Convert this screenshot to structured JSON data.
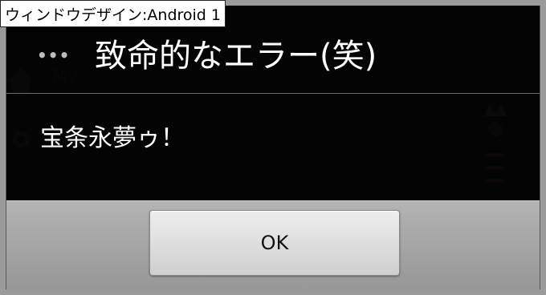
{
  "caption": "ウィンドウデザイン:Android 1",
  "dialog": {
    "title": "致命的なエラー(笑)",
    "message": "宝条永夢ゥ！",
    "ok_label": "OK",
    "menu_icon": "overflow-dots-icon"
  },
  "background_app": {
    "visible_text": "My"
  },
  "colors": {
    "dialog_body": "#000000",
    "button_bar": "#a8a8a8",
    "button_face": "#e0e0e0",
    "title_text": "#ffffff"
  }
}
